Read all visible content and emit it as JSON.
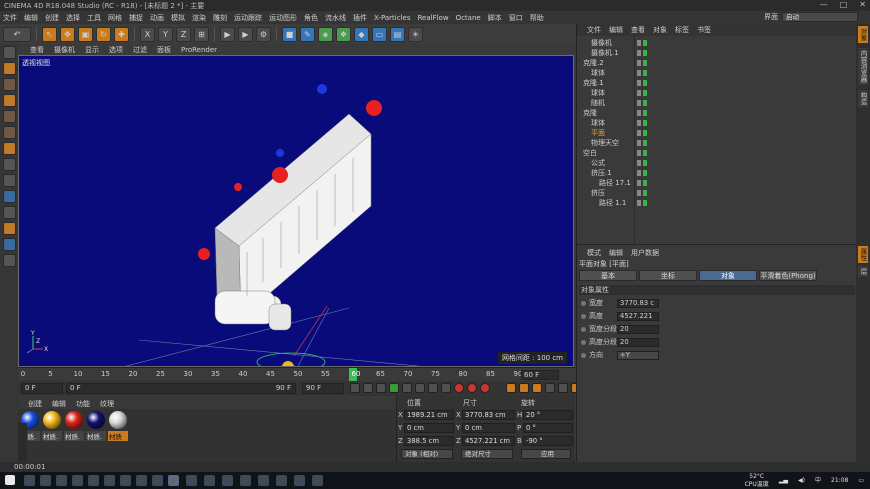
{
  "app": {
    "title": "CINEMA 4D R18.048 Studio (RC - R18) - [未标题 2 *] - 主要"
  },
  "menubar": {
    "items": [
      "文件",
      "编辑",
      "创建",
      "选择",
      "工具",
      "网格",
      "捕捉",
      "动画",
      "模拟",
      "渲染",
      "雕刻",
      "运动跟踪",
      "运动图形",
      "角色",
      "流水线",
      "插件",
      "X-Particles",
      "RealFlow",
      "Octane",
      "脚本",
      "窗口",
      "帮助"
    ],
    "layout_label": "界面",
    "layout_value": "启动"
  },
  "viewport": {
    "menu": [
      "查看",
      "摄像机",
      "显示",
      "选项",
      "过滤",
      "面板",
      "ProRender"
    ],
    "label": "透视视图",
    "grid_text": "网格间距 : 100 cm",
    "axis_y": "Y",
    "axis_z": "Z",
    "axis_x": "X",
    "bg_color": "#0a0b7a"
  },
  "timeline": {
    "ticks": [
      "0",
      "5",
      "10",
      "15",
      "20",
      "25",
      "30",
      "35",
      "40",
      "45",
      "50",
      "55",
      "60",
      "65",
      "70",
      "75",
      "80",
      "85",
      "90"
    ],
    "current_frame_label": "60",
    "current_frame": 60,
    "end_field": "60 F"
  },
  "transport": {
    "start_field": "0 F",
    "current_field": "0 F",
    "range_end": "90 F",
    "end_field": "90 F"
  },
  "materials": {
    "menu": [
      "创建",
      "编辑",
      "功能",
      "纹理"
    ],
    "items": [
      {
        "label": "材质.",
        "color": "#1a4ee0"
      },
      {
        "label": "材质.",
        "color": "#f0b81a"
      },
      {
        "label": "材质.",
        "color": "#e0201a"
      },
      {
        "label": "材质.",
        "color": "#101070"
      },
      {
        "label": "材质",
        "color": "#d8d8d8",
        "selected": true
      }
    ]
  },
  "coords": {
    "headers": [
      "位置",
      "尺寸",
      "旋转"
    ],
    "position": {
      "x": "1989.21 cm",
      "y": "0 cm",
      "z": "388.5 cm"
    },
    "size": {
      "x": "3770.83 cm",
      "y": "0 cm",
      "z": "4527.221 cm"
    },
    "rotation": {
      "h": "20 °",
      "p": "0 °",
      "b": "-90 °"
    },
    "labels": {
      "x": "X",
      "y": "Y",
      "z": "Z",
      "h": "H",
      "p": "P",
      "b": "B"
    },
    "mode_select": "对象 (相对)",
    "size_select": "绝对尺寸",
    "apply": "应用"
  },
  "objects": {
    "menu": [
      "文件",
      "编辑",
      "查看",
      "对象",
      "标签",
      "书签"
    ],
    "rows": [
      {
        "name": "摄像机",
        "indent": 1
      },
      {
        "name": "摄像机.1",
        "indent": 1
      },
      {
        "name": "克隆.2",
        "indent": 0
      },
      {
        "name": "球体",
        "indent": 1
      },
      {
        "name": "克隆.1",
        "indent": 0
      },
      {
        "name": "球体",
        "indent": 1
      },
      {
        "name": "随机",
        "indent": 1
      },
      {
        "name": "克隆",
        "indent": 0
      },
      {
        "name": "球体",
        "indent": 1
      },
      {
        "name": "平面",
        "indent": 1,
        "highlight": true
      },
      {
        "name": "物理天空",
        "indent": 1
      },
      {
        "name": "空白",
        "indent": 0
      },
      {
        "name": "公式",
        "indent": 1
      },
      {
        "name": "挤压.1",
        "indent": 1
      },
      {
        "name": "路径 17.1",
        "indent": 2
      },
      {
        "name": "挤压",
        "indent": 1
      },
      {
        "name": "路径 1.1",
        "indent": 2
      }
    ]
  },
  "attributes": {
    "menu": [
      "模式",
      "编辑",
      "用户数据"
    ],
    "title": "平面对象 [平面]",
    "tabs": [
      "基本",
      "坐标",
      "对象",
      "平滑着色(Phong)"
    ],
    "active_tab": "对象",
    "section": "对象属性",
    "props": [
      {
        "label": "宽度",
        "value": "3770.83 c"
      },
      {
        "label": "高度",
        "value": "4527.221"
      },
      {
        "label": "宽度分段",
        "value": "20"
      },
      {
        "label": "高度分段",
        "value": "20"
      },
      {
        "label": "方向",
        "value": "+Y"
      }
    ]
  },
  "sidetabs": [
    "对象",
    "内容浏览器",
    "构造",
    "属性",
    "层"
  ],
  "status": {
    "time": "00:00:01"
  },
  "taskbar": {
    "temp": "52°C",
    "cpu": "CPU温度",
    "ime": "中",
    "clock": "21:08"
  }
}
